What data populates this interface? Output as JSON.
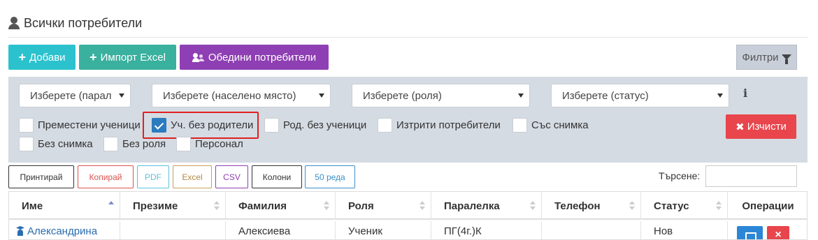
{
  "header": {
    "title": "Всички потребители"
  },
  "toolbar": {
    "add_label": "Добави",
    "import_label": "Импорт Excel",
    "merge_label": "Обедини потребители",
    "filters_label": "Филтри"
  },
  "filters": {
    "selects": [
      {
        "value": "Изберете (парал"
      },
      {
        "value": "Изберете (населено място)"
      },
      {
        "value": "Изберете (роля)"
      },
      {
        "value": "Изберете (статус)"
      }
    ],
    "checkboxes": [
      {
        "label": "Преместени ученици",
        "checked": false
      },
      {
        "label": "Уч. без родители",
        "checked": true
      },
      {
        "label": "Род. без ученици",
        "checked": false
      },
      {
        "label": "Изтрити потребители",
        "checked": false
      },
      {
        "label": "Със снимка",
        "checked": false
      },
      {
        "label": "Без снимка",
        "checked": false
      },
      {
        "label": "Без роля",
        "checked": false
      },
      {
        "label": "Персонал",
        "checked": false
      }
    ],
    "clear_label": "Изчисти",
    "info_icon": "i"
  },
  "table_tools": {
    "print": "Принтирай",
    "copy": "Копирай",
    "pdf": "PDF",
    "excel": "Excel",
    "csv": "CSV",
    "columns": "Колони",
    "rows": "50 реда"
  },
  "search": {
    "label": "Търсене:",
    "value": ""
  },
  "table": {
    "columns": [
      "Име",
      "Презиме",
      "Фамилия",
      "Роля",
      "Паралелка",
      "Телефон",
      "Статус",
      "Операции"
    ],
    "rows": [
      {
        "name": "Александрина",
        "middle": "",
        "last": "Алексиева",
        "role": "Ученик",
        "class": "ПГ(4г.)К",
        "phone": "",
        "status": "Нов"
      }
    ]
  },
  "colors": {
    "add": "#2bc2ce",
    "import": "#3ab09e",
    "merge": "#8e3fb3",
    "clear": "#e8454c",
    "edit": "#2b86d6",
    "highlight": "#e02020"
  }
}
